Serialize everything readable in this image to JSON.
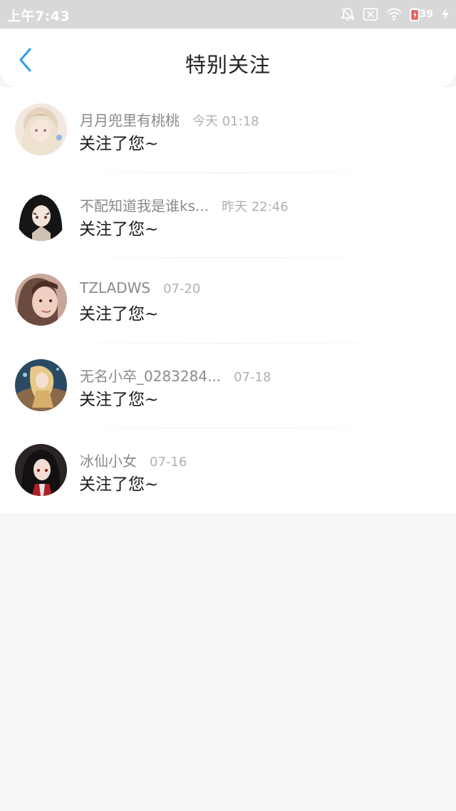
{
  "status_bar": {
    "time": "上午7:43",
    "battery": "39",
    "icons": [
      "bell-off-icon",
      "sim-none-icon",
      "wifi-icon",
      "battery-icon",
      "charging-icon"
    ]
  },
  "header": {
    "title": "特别关注",
    "back_icon": "chevron-left-icon",
    "accent": "#2a9df4"
  },
  "notifications": [
    {
      "name": "月月兜里有桃桃",
      "time": "今天 01:18",
      "message": "关注了您~"
    },
    {
      "name": "不配知道我是谁ks...",
      "time": "昨天 22:46",
      "message": "关注了您~"
    },
    {
      "name": "TZLADWS",
      "time": "07-20",
      "message": "关注了您~"
    },
    {
      "name": "无名小卒_0283284...",
      "time": "07-18",
      "message": "关注了您~"
    },
    {
      "name": "冰仙小女",
      "time": "07-16",
      "message": "关注了您~"
    }
  ]
}
